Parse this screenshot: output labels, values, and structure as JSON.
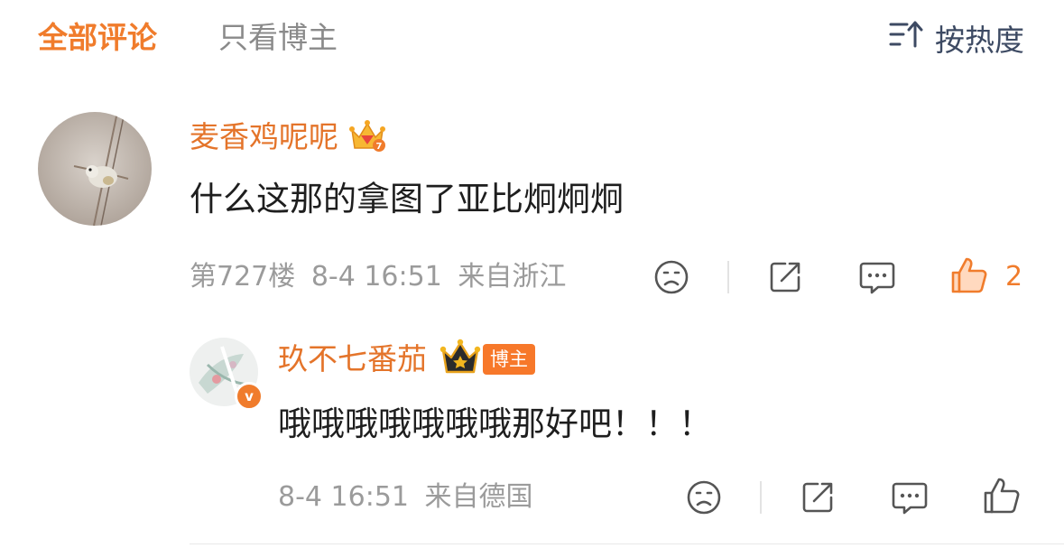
{
  "tabs": {
    "all": "全部评论",
    "author_only": "只看博主"
  },
  "sort": {
    "label": "按热度",
    "icon": "sort-icon"
  },
  "comment": {
    "username": "麦香鸡呢呢",
    "text": "什么这那的拿图了亚比炯炯炯",
    "floor": "第727楼",
    "time": "8-4 16:51",
    "location": "来自浙江",
    "like_count": "2"
  },
  "reply": {
    "username": "玖不七番茄",
    "tag": "博主",
    "verified": "v",
    "text": "哦哦哦哦哦哦哦那好吧！！！",
    "time": "8-4 16:51",
    "location": "来自德国"
  },
  "colors": {
    "accent": "#f07c2c",
    "text": "#1e1e1e",
    "muted": "#9b9b9b",
    "icon": "#3d4a63"
  }
}
